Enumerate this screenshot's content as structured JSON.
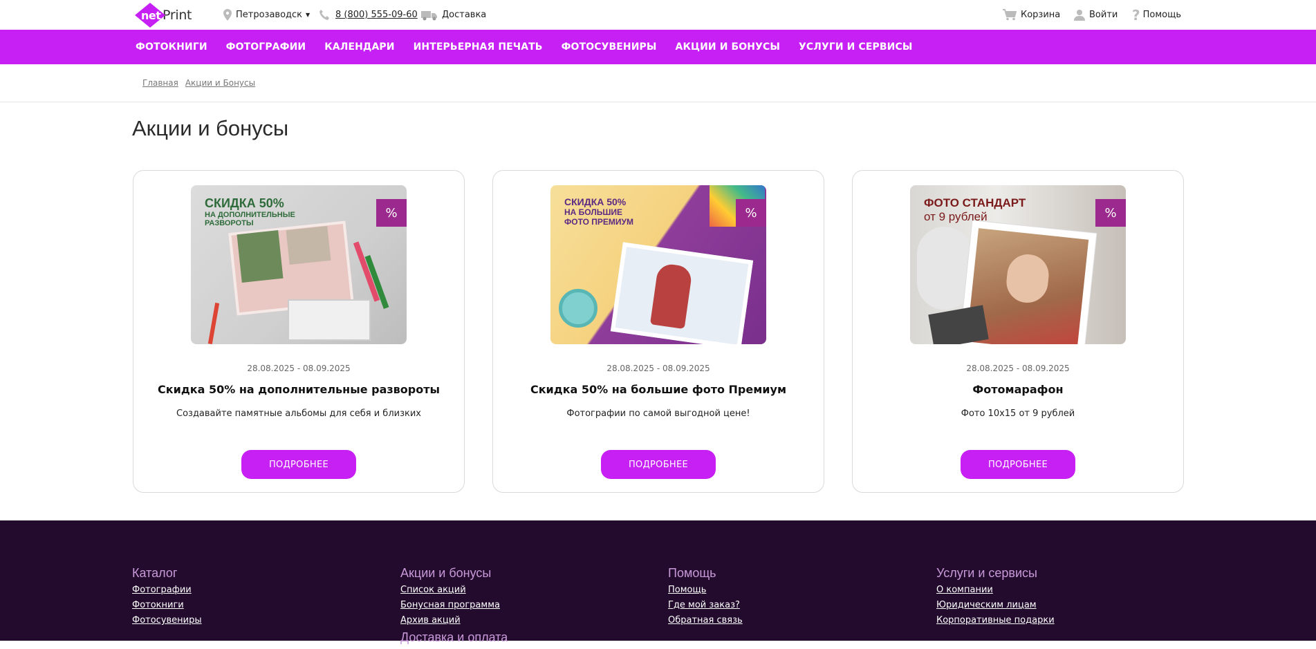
{
  "header": {
    "logo_net": "net",
    "logo_print": "Print",
    "city": "Петрозаводск",
    "phone": "8 (800) 555-09-60",
    "delivery": "Доставка",
    "cart": "Корзина",
    "login": "Войти",
    "help": "Помощь"
  },
  "nav": {
    "items": [
      {
        "label": "ФОТОКНИГИ"
      },
      {
        "label": "ФОТОГРАФИИ"
      },
      {
        "label": "КАЛЕНДАРИ"
      },
      {
        "label": "ИНТЕРЬЕРНАЯ ПЕЧАТЬ"
      },
      {
        "label": "ФОТОСУВЕНИРЫ"
      },
      {
        "label": "АКЦИИ И БОНУСЫ"
      },
      {
        "label": "УСЛУГИ И СЕРВИСЫ"
      }
    ]
  },
  "breadcrumb": {
    "home": "Главная",
    "current": "Акции и Бонусы"
  },
  "page": {
    "title": "Акции и бонусы"
  },
  "promos": [
    {
      "image_line1": "СКИДКА 50%",
      "image_line2": "НА ДОПОЛНИТЕЛЬНЫЕ",
      "image_line3": "РАЗВОРОТЫ",
      "badge": "%",
      "dates": "28.08.2025 - 08.09.2025",
      "title": "Скидка 50% на дополнительные развороты",
      "description": "Создавайте памятные альбомы для себя и близких",
      "button": "ПОДРОБНЕЕ",
      "color_headline": "#2e6b3a"
    },
    {
      "image_line1": "СКИДКА 50%",
      "image_line2": "НА БОЛЬШИЕ",
      "image_line3": "ФОТО ПРЕМИУМ",
      "badge": "%",
      "dates": "28.08.2025 - 08.09.2025",
      "title": "Скидка 50% на большие фото Премиум",
      "description": "Фотографии по самой выгодной цене!",
      "button": "ПОДРОБНЕЕ",
      "color_headline": "#5b2a83"
    },
    {
      "image_line1": "ФОТО СТАНДАРТ",
      "image_line2": "от 9 рублей",
      "image_line3": "",
      "badge": "%",
      "dates": "28.08.2025 - 08.09.2025",
      "title": "Фотомарафон",
      "description": "Фото 10х15 от 9 рублей",
      "button": "ПОДРОБНЕЕ",
      "color_headline": "#7a1a1a"
    }
  ],
  "footer": {
    "catalog": {
      "heading": "Каталог",
      "links": [
        "Фотографии",
        "Фотокниги",
        "Фотосувениры"
      ]
    },
    "promos": {
      "heading": "Акции и бонусы",
      "links": [
        "Список акций",
        "Бонусная программа",
        "Архив акций"
      ],
      "heading2": "Доставка и оплата"
    },
    "help": {
      "heading": "Помощь",
      "links": [
        "Помощь",
        "Где мой заказ?",
        "Обратная связь"
      ]
    },
    "services": {
      "heading": "Услуги и сервисы",
      "links": [
        "О компании",
        "Юридическим лицам",
        "Корпоративные подарки"
      ]
    }
  },
  "colors": {
    "accent": "#c620f5",
    "footer_bg": "#220b2d",
    "badge": "#9c2a8e"
  }
}
